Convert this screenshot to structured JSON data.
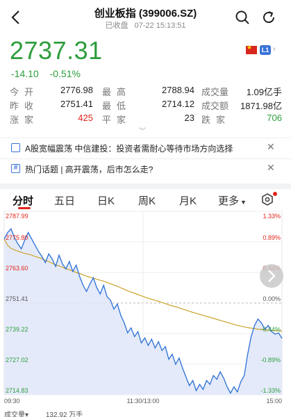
{
  "header": {
    "title": "创业板指 (399006.SZ)",
    "status": "已收盘",
    "datetime": "07-22 15:13:51"
  },
  "quote": {
    "price": "2737.31",
    "change": "-14.10",
    "change_pct": "-0.51%",
    "level_badge": "L1"
  },
  "stats": [
    [
      {
        "label": "今开",
        "value": "2776.98"
      },
      {
        "label": "最高",
        "value": "2788.94"
      },
      {
        "label": "成交量",
        "value": "1.09亿手"
      }
    ],
    [
      {
        "label": "昨收",
        "value": "2751.41"
      },
      {
        "label": "最低",
        "value": "2714.12"
      },
      {
        "label": "成交额",
        "value": "1871.98亿"
      }
    ],
    [
      {
        "label": "涨家",
        "value": "425"
      },
      {
        "label": "平家",
        "value": "23"
      },
      {
        "label": "跌家",
        "value": "706"
      }
    ]
  ],
  "news": [
    {
      "text": "A股宽幅震荡 中信建投：投资者需耐心等待市场方向选择"
    },
    {
      "text": "热门话题 | 高开震荡，后市怎么走?"
    }
  ],
  "tabs": [
    "分时",
    "五日",
    "日K",
    "周K",
    "月K",
    "更多"
  ],
  "colors": {
    "up": "#e2241a",
    "down": "#2e9d3c",
    "price_line": "#2b6fd6",
    "avg_line": "#c9a227"
  },
  "chart_data": {
    "type": "line",
    "x_ticks": [
      "09:30",
      "11:30/13:00",
      "15:00"
    ],
    "y_left_ticks": [
      "2787.99",
      "2775.80",
      "2763.60",
      "2751.41",
      "2739.22",
      "2727.02",
      "2714.83"
    ],
    "y_right_ticks": [
      "1.33%",
      "0.89%",
      "0.44%",
      "0.00%",
      "-0.44%",
      "-0.89%",
      "-1.33%"
    ],
    "ylim": [
      2714.83,
      2787.99
    ],
    "prev_close": 2751.41,
    "series": [
      {
        "values": [
          2776.9,
          2779.5,
          2781.0,
          2777.5,
          2775.0,
          2773.0,
          2776.5,
          2779.5,
          2777.0,
          2774.5,
          2772.0,
          2770.0,
          2767.5,
          2771.0,
          2769.0,
          2766.0,
          2770.5,
          2767.0,
          2765.0,
          2768.0,
          2764.0,
          2766.5,
          2762.0,
          2758.5,
          2756.0,
          2759.0,
          2761.5,
          2757.5,
          2755.0,
          2758.5,
          2754.0,
          2752.5,
          2749.0,
          2751.0,
          2746.5,
          2743.5,
          2739.5,
          2741.5,
          2738.0,
          2740.0,
          2735.5,
          2737.5,
          2734.5,
          2737.0,
          2733.5,
          2736.0,
          2732.5,
          2734.0,
          2729.0,
          2731.0,
          2727.0,
          2729.5,
          2725.5,
          2722.0,
          2718.5,
          2720.5,
          2716.5,
          2719.0,
          2717.0,
          2720.5,
          2719.0,
          2722.5,
          2721.0,
          2724.0,
          2721.5,
          2718.0,
          2715.5,
          2718.0,
          2716.0,
          2720.0,
          2722.5,
          2731.0,
          2738.0,
          2742.5,
          2745.0,
          2743.5,
          2741.0,
          2742.5,
          2740.0,
          2739.0,
          2739.5,
          2737.3
        ]
      },
      {
        "values": [
          2776.9,
          2774.5,
          2773.2,
          2772.6,
          2772.1,
          2771.6,
          2771.2,
          2770.9,
          2770.5,
          2770.0,
          2769.6,
          2769.1,
          2768.4,
          2767.9,
          2767.3,
          2766.6,
          2766.2,
          2765.7,
          2765.1,
          2764.7,
          2764.1,
          2763.6,
          2763.2,
          2762.7,
          2762.1,
          2761.7,
          2761.3,
          2760.9,
          2760.5,
          2760.1,
          2759.6,
          2759.1,
          2758.6,
          2758.1,
          2757.5,
          2756.9,
          2756.3,
          2755.8,
          2755.3,
          2754.8,
          2754.3,
          2753.8,
          2753.3,
          2752.9,
          2752.5,
          2752.1,
          2751.6,
          2751.2,
          2750.7,
          2750.3,
          2749.9,
          2749.5,
          2749.0,
          2748.6,
          2748.1,
          2747.7,
          2747.3,
          2746.9,
          2746.5,
          2746.1,
          2745.7,
          2745.3,
          2744.9,
          2744.5,
          2744.1,
          2743.7,
          2743.3,
          2742.9,
          2742.5,
          2742.2,
          2741.9,
          2741.6,
          2741.4,
          2741.2,
          2741.0,
          2740.9,
          2740.7,
          2740.6,
          2740.5,
          2740.4,
          2740.3,
          2740.2
        ]
      }
    ]
  },
  "volume": {
    "label": "成交量",
    "value": "132.92 万手"
  }
}
